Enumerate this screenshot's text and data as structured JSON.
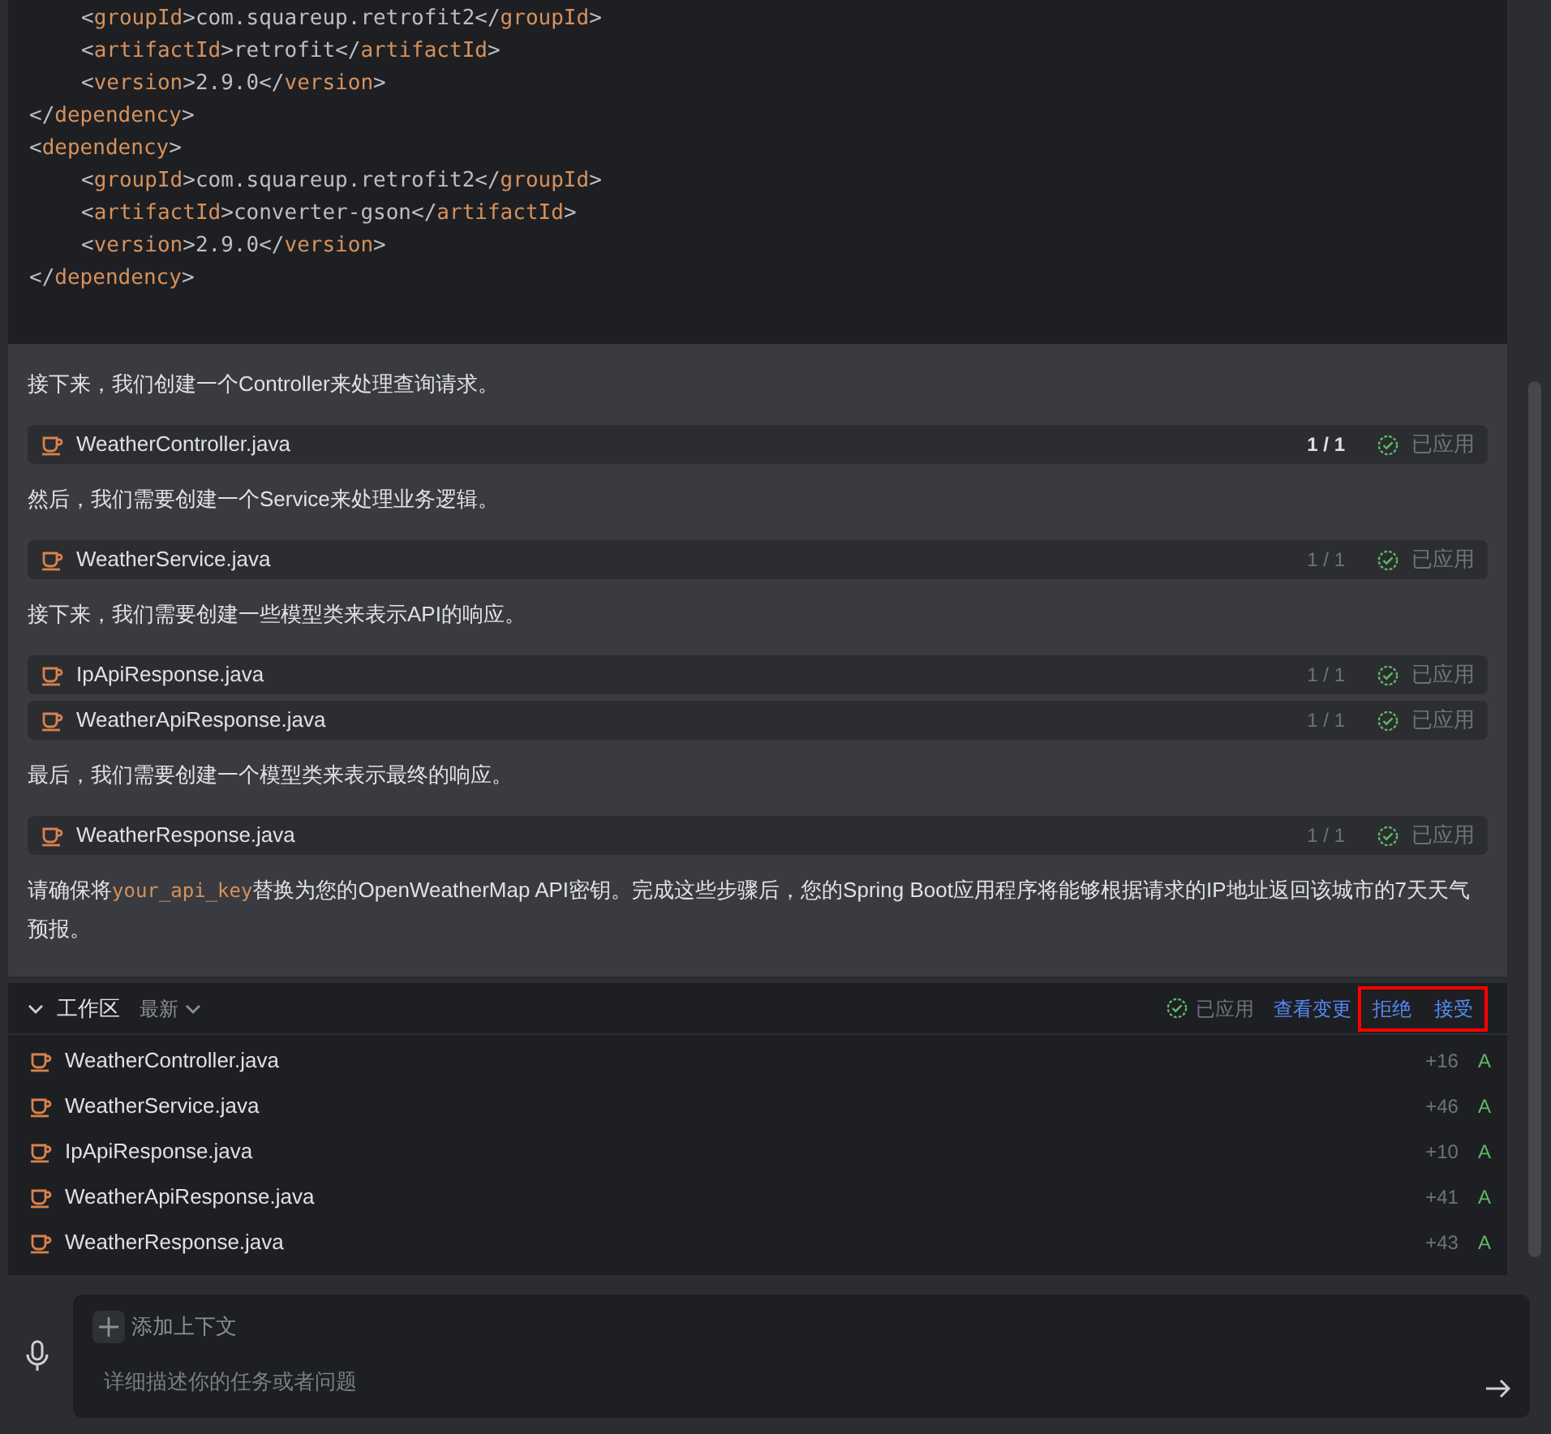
{
  "code_block": {
    "lines": [
      {
        "indented": true,
        "tokens": [
          {
            "kind": "punct",
            "text": "<"
          },
          {
            "kind": "tag",
            "text": "groupId"
          },
          {
            "kind": "punct",
            "text": ">"
          },
          {
            "kind": "text",
            "text": "com.squareup.retrofit2"
          },
          {
            "kind": "punct",
            "text": "</"
          },
          {
            "kind": "tag",
            "text": "groupId"
          },
          {
            "kind": "punct",
            "text": ">"
          }
        ]
      },
      {
        "indented": true,
        "tokens": [
          {
            "kind": "punct",
            "text": "<"
          },
          {
            "kind": "tag",
            "text": "artifactId"
          },
          {
            "kind": "punct",
            "text": ">"
          },
          {
            "kind": "text",
            "text": "retrofit"
          },
          {
            "kind": "punct",
            "text": "</"
          },
          {
            "kind": "tag",
            "text": "artifactId"
          },
          {
            "kind": "punct",
            "text": ">"
          }
        ]
      },
      {
        "indented": true,
        "tokens": [
          {
            "kind": "punct",
            "text": "<"
          },
          {
            "kind": "tag",
            "text": "version"
          },
          {
            "kind": "punct",
            "text": ">"
          },
          {
            "kind": "text",
            "text": "2.9.0"
          },
          {
            "kind": "punct",
            "text": "</"
          },
          {
            "kind": "tag",
            "text": "version"
          },
          {
            "kind": "punct",
            "text": ">"
          }
        ]
      },
      {
        "indented": false,
        "tokens": [
          {
            "kind": "punct",
            "text": "</"
          },
          {
            "kind": "tag",
            "text": "dependency"
          },
          {
            "kind": "punct",
            "text": ">"
          }
        ]
      },
      {
        "indented": false,
        "tokens": [
          {
            "kind": "punct",
            "text": "<"
          },
          {
            "kind": "tag",
            "text": "dependency"
          },
          {
            "kind": "punct",
            "text": ">"
          }
        ]
      },
      {
        "indented": true,
        "tokens": [
          {
            "kind": "punct",
            "text": "<"
          },
          {
            "kind": "tag",
            "text": "groupId"
          },
          {
            "kind": "punct",
            "text": ">"
          },
          {
            "kind": "text",
            "text": "com.squareup.retrofit2"
          },
          {
            "kind": "punct",
            "text": "</"
          },
          {
            "kind": "tag",
            "text": "groupId"
          },
          {
            "kind": "punct",
            "text": ">"
          }
        ]
      },
      {
        "indented": true,
        "tokens": [
          {
            "kind": "punct",
            "text": "<"
          },
          {
            "kind": "tag",
            "text": "artifactId"
          },
          {
            "kind": "punct",
            "text": ">"
          },
          {
            "kind": "text",
            "text": "converter-gson"
          },
          {
            "kind": "punct",
            "text": "</"
          },
          {
            "kind": "tag",
            "text": "artifactId"
          },
          {
            "kind": "punct",
            "text": ">"
          }
        ]
      },
      {
        "indented": true,
        "tokens": [
          {
            "kind": "punct",
            "text": "<"
          },
          {
            "kind": "tag",
            "text": "version"
          },
          {
            "kind": "punct",
            "text": ">"
          },
          {
            "kind": "text",
            "text": "2.9.0"
          },
          {
            "kind": "punct",
            "text": "</"
          },
          {
            "kind": "tag",
            "text": "version"
          },
          {
            "kind": "punct",
            "text": ">"
          }
        ]
      },
      {
        "indented": false,
        "tokens": [
          {
            "kind": "punct",
            "text": "</"
          },
          {
            "kind": "tag",
            "text": "dependency"
          },
          {
            "kind": "punct",
            "text": ">"
          }
        ]
      }
    ]
  },
  "messages": [
    {
      "kind": "text",
      "parts": [
        {
          "text": "接下来，我们创建一个Controller来处理查询请求。",
          "code": false
        }
      ]
    },
    {
      "kind": "file",
      "name": "WeatherController.java",
      "count": "1 / 1",
      "status": "已应用",
      "selected": true
    },
    {
      "kind": "text",
      "parts": [
        {
          "text": "然后，我们需要创建一个Service来处理业务逻辑。",
          "code": false
        }
      ]
    },
    {
      "kind": "file",
      "name": "WeatherService.java",
      "count": "1 / 1",
      "status": "已应用",
      "selected": false
    },
    {
      "kind": "text",
      "parts": [
        {
          "text": "接下来，我们需要创建一些模型类来表示API的响应。",
          "code": false
        }
      ]
    },
    {
      "kind": "file",
      "name": "IpApiResponse.java",
      "count": "1 / 1",
      "status": "已应用",
      "selected": false
    },
    {
      "kind": "file",
      "name": "WeatherApiResponse.java",
      "count": "1 / 1",
      "status": "已应用",
      "selected": false
    },
    {
      "kind": "text",
      "parts": [
        {
          "text": "最后，我们需要创建一个模型类来表示最终的响应。",
          "code": false
        }
      ]
    },
    {
      "kind": "file",
      "name": "WeatherResponse.java",
      "count": "1 / 1",
      "status": "已应用",
      "selected": false
    },
    {
      "kind": "text",
      "parts": [
        {
          "text": "请确保将",
          "code": false
        },
        {
          "text": "your_api_key",
          "code": true
        },
        {
          "text": "替换为您的OpenWeatherMap API密钥。完成这些步骤后，您的Spring Boot应用程序将能够根据请求的IP地址返回该城市的7天天气预报。",
          "code": false
        }
      ]
    }
  ],
  "workspace": {
    "title": "工作区",
    "filter": "最新",
    "expanded": true,
    "status": "已应用",
    "view_changes": "查看变更",
    "actions_highlighted": true,
    "reject": "拒绝",
    "accept": "接受",
    "files": [
      {
        "name": "WeatherController.java",
        "added": "+16",
        "state": "A"
      },
      {
        "name": "WeatherService.java",
        "added": "+46",
        "state": "A"
      },
      {
        "name": "IpApiResponse.java",
        "added": "+10",
        "state": "A"
      },
      {
        "name": "WeatherApiResponse.java",
        "added": "+41",
        "state": "A"
      },
      {
        "name": "WeatherResponse.java",
        "added": "+43",
        "state": "A"
      }
    ]
  },
  "input": {
    "add_context": "添加上下文",
    "placeholder": "详细描述你的任务或者问题"
  }
}
